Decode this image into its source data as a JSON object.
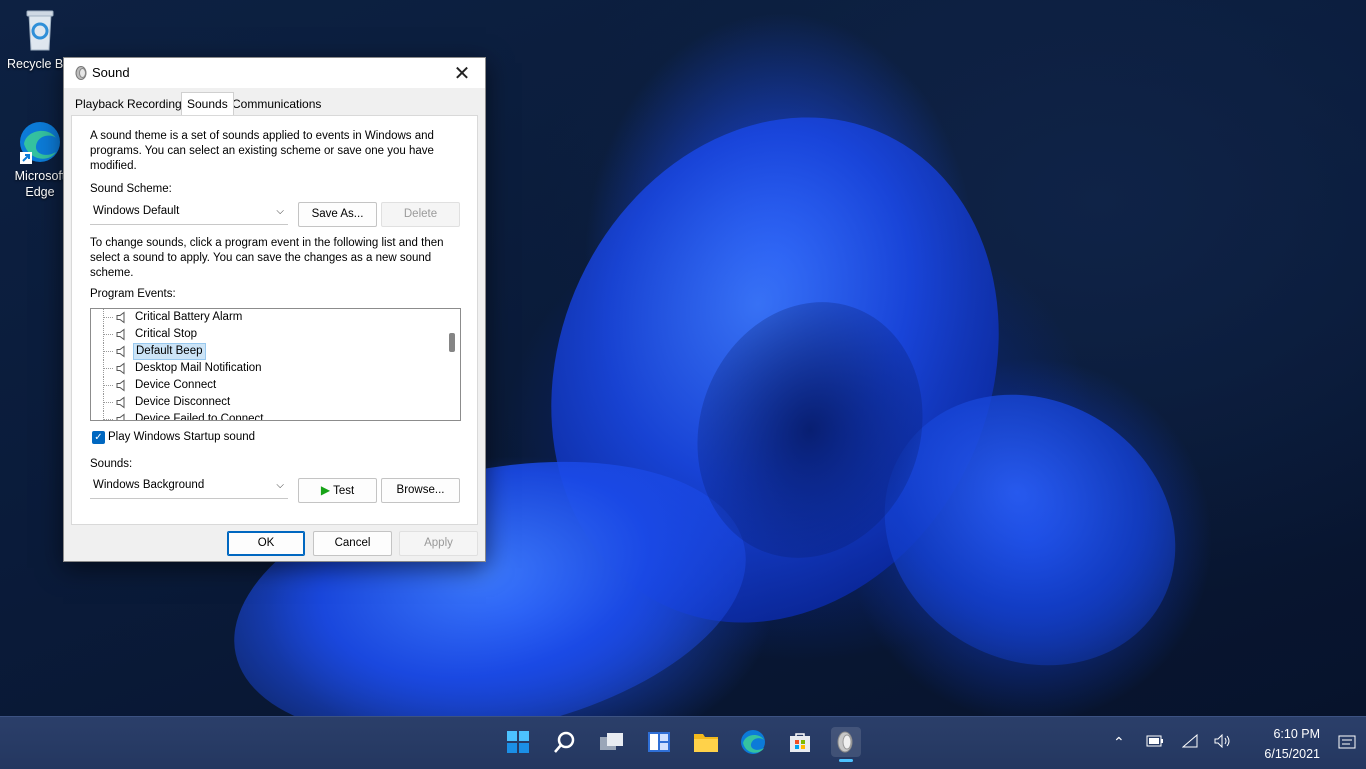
{
  "desktop": {
    "icons": [
      {
        "label": "Recycle Bin"
      },
      {
        "label": "Microsoft Edge"
      }
    ]
  },
  "dialog": {
    "title": "Sound",
    "tabs": [
      {
        "label": "Playback"
      },
      {
        "label": "Recording"
      },
      {
        "label": "Sounds",
        "active": true
      },
      {
        "label": "Communications"
      }
    ],
    "intro": "A sound theme is a set of sounds applied to events in Windows and programs.  You can select an existing scheme or save one you have modified.",
    "scheme_label": "Sound Scheme:",
    "scheme_value": "Windows Default",
    "save_as_label": "Save As...",
    "delete_label": "Delete",
    "change_text": "To change sounds, click a program event in the following list and then select a sound to apply.  You can save the changes as a new sound scheme.",
    "events_label": "Program Events:",
    "events": [
      {
        "label": "Critical Battery Alarm"
      },
      {
        "label": "Critical Stop"
      },
      {
        "label": "Default Beep",
        "selected": true
      },
      {
        "label": "Desktop Mail Notification"
      },
      {
        "label": "Device Connect"
      },
      {
        "label": "Device Disconnect"
      },
      {
        "label": "Device Failed to Connect"
      }
    ],
    "startup_label": "Play Windows Startup sound",
    "startup_checked": true,
    "sounds_label": "Sounds:",
    "sound_value": "Windows Background",
    "test_label": "Test",
    "browse_label": "Browse...",
    "ok_label": "OK",
    "cancel_label": "Cancel",
    "apply_label": "Apply"
  },
  "taskbar": {
    "pinned": [
      "start-icon",
      "search-icon",
      "task-view-icon",
      "widgets-icon",
      "file-explorer-icon",
      "edge-icon",
      "store-icon",
      "sound-settings-icon"
    ],
    "time": "6:10 PM",
    "date": "6/15/2021"
  },
  "colors": {
    "accent": "#0067c0",
    "selection": "#cce4f7",
    "taskbar": "#243760"
  }
}
